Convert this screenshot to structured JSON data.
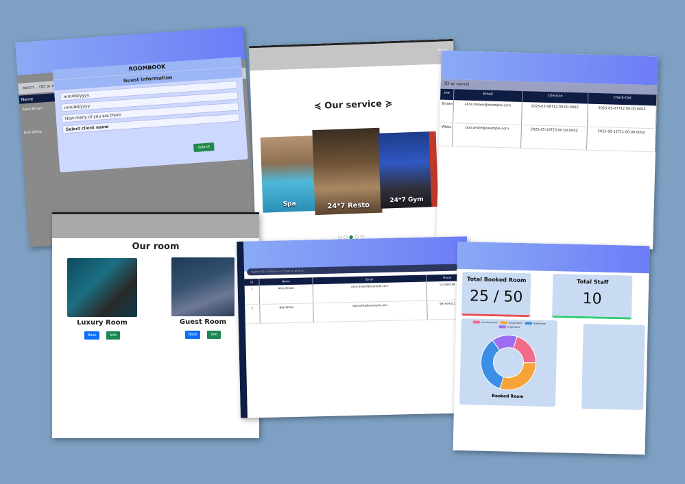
{
  "booking": {
    "brand": "ROOMBOOK",
    "modal_title": "Guest information",
    "search_placeholder": "earch... (ID or name",
    "col_name": "Name",
    "row1": "Alice Brown",
    "row2": "Bob White",
    "fields": [
      "mm/dd/yyyy",
      "mm/dd/yyyy",
      "How many of you are there",
      "Select client name"
    ],
    "submit": "Submit"
  },
  "services": {
    "title": "Our service",
    "items": [
      {
        "label": "Spa"
      },
      {
        "label": "24*7 Resto"
      },
      {
        "label": "24*7 Gym"
      }
    ],
    "corner": "Home"
  },
  "reservations": {
    "search": "(ID or name)",
    "columns": [
      "me",
      "Email",
      "Check-In",
      "Check-Out"
    ],
    "rows": [
      [
        "Brown",
        "alice.brown@example.com",
        "2025-05-06T12:00:00.000Z",
        "2025-05-07T12:00:00.000Z"
      ],
      [
        "White",
        "bob.white@example.com",
        "2025-05-10T15:00:00.000Z",
        "2025-05-12T11:00:00.000Z"
      ]
    ]
  },
  "rooms": {
    "title": "Our room",
    "items": [
      {
        "name": "Luxury Room",
        "book": "Book",
        "info": "Info"
      },
      {
        "name": "Guest Room",
        "book": "Book",
        "info": "Info"
      }
    ]
  },
  "guests": {
    "search": "Search (ID or Name or Email or phone)",
    "columns": [
      "Id",
      "Name",
      "Email",
      "Phone"
    ],
    "rows": [
      [
        "1",
        "Alice Brown",
        "alice.brown@example.com",
        "123456789"
      ],
      [
        "2",
        "Bob White",
        "bob.white@example.com",
        "987654321"
      ]
    ]
  },
  "dashboard": {
    "stat1_title": "Total Booked Room",
    "stat1_value": "25 / 50",
    "stat2_title": "Total Staff",
    "stat2_value": "10",
    "chart_title": "Booked Room",
    "chart_data": {
      "type": "pie",
      "categories": [
        "Luxurious Room",
        "Deluxe Room",
        "Guest Room",
        "Single Room"
      ],
      "values": [
        20,
        30,
        35,
        15
      ],
      "colors": [
        "#f26b8a",
        "#f6a43a",
        "#3a8ee6",
        "#9b6ff0"
      ]
    }
  },
  "accent": "#6d7cf7"
}
